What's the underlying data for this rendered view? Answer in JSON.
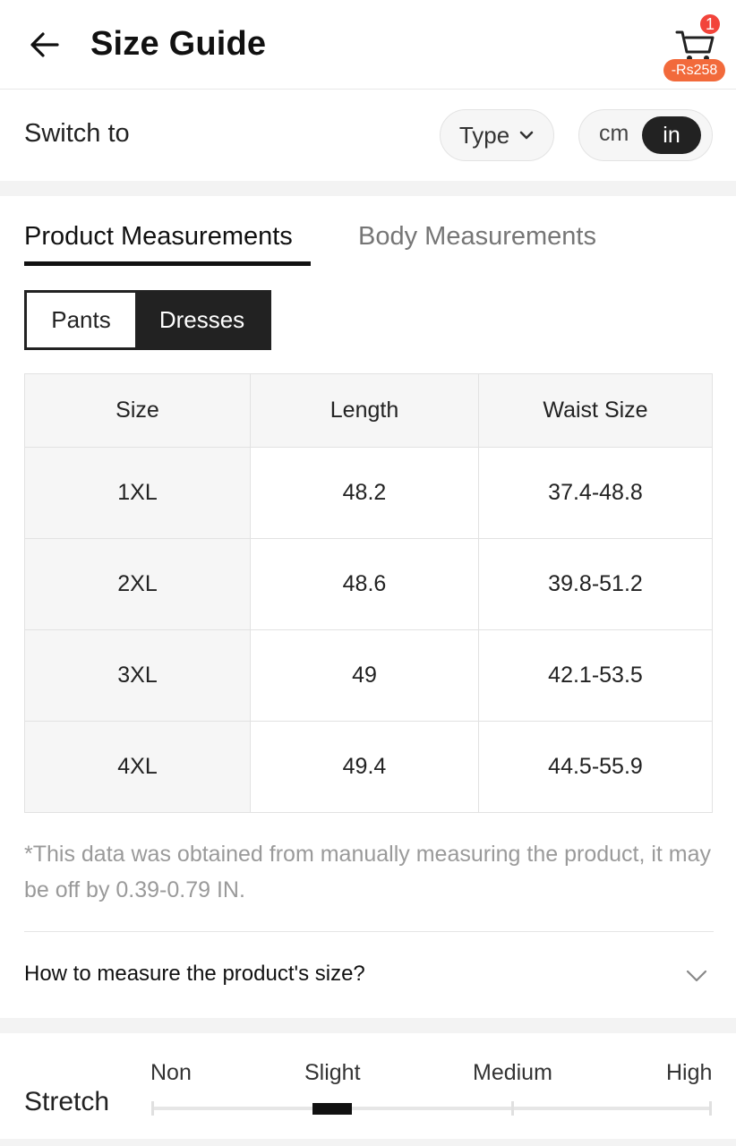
{
  "header": {
    "title": "Size Guide",
    "cart_count": "1",
    "cart_price": "-Rs258"
  },
  "switch": {
    "label": "Switch to",
    "type_label": "Type",
    "unit_options": [
      "cm",
      "in"
    ],
    "unit_selected": "in"
  },
  "tabs": [
    {
      "label": "Product Measurements",
      "active": true
    },
    {
      "label": "Body Measurements",
      "active": false
    }
  ],
  "segments": [
    {
      "label": "Pants",
      "selected": false
    },
    {
      "label": "Dresses",
      "selected": true
    }
  ],
  "table": {
    "headers": [
      "Size",
      "Length",
      "Waist Size"
    ],
    "rows": [
      [
        "1XL",
        "48.2",
        "37.4-48.8"
      ],
      [
        "2XL",
        "48.6",
        "39.8-51.2"
      ],
      [
        "3XL",
        "49",
        "42.1-53.5"
      ],
      [
        "4XL",
        "49.4",
        "44.5-55.9"
      ]
    ]
  },
  "note": "*This data was obtained from manually measuring the product, it may be off by 0.39-0.79 IN.",
  "how_to_measure": "How to measure the product's size?",
  "stretch": {
    "label": "Stretch",
    "levels": [
      "Non",
      "Slight",
      "Medium",
      "High"
    ],
    "selected": "Slight"
  },
  "icons": {
    "back": "back-arrow-icon",
    "cart": "cart-icon",
    "chevron": "chevron-down-icon"
  },
  "colors": {
    "accent_badge": "#f2443b",
    "price_badge": "#f26a3b",
    "dark": "#222222"
  }
}
